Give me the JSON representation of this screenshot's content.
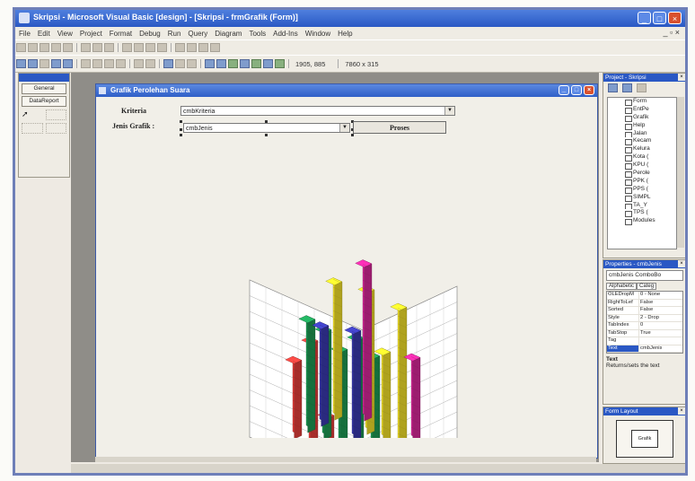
{
  "window": {
    "title": "Skripsi - Microsoft Visual Basic [design] - [Skripsi - frmGrafik (Form)]"
  },
  "menu": [
    "File",
    "Edit",
    "View",
    "Project",
    "Format",
    "Debug",
    "Run",
    "Query",
    "Diagram",
    "Tools",
    "Add-Ins",
    "Window",
    "Help"
  ],
  "toolbar": {
    "position": "1905, 885",
    "size": "7860 x 315"
  },
  "toolbox": {
    "tabs": [
      "General",
      "DataReport"
    ]
  },
  "form": {
    "caption": "Grafik Perolehan Suara",
    "kriteria_label": "Kriteria",
    "kriteria_value": "cmbKriteria",
    "jenis_label": "Jenis Grafik :",
    "jenis_value": "cmbJenis",
    "button_label": "Proses"
  },
  "project": {
    "title": "Project - Skripsi",
    "items": [
      "Form",
      "EntPe",
      "Grafik",
      "Help",
      "Jalan",
      "Kecam",
      "Kelura",
      "Kota (",
      "KPU (",
      "Perole",
      "PPK (",
      "PPS (",
      "SIMPL",
      "TA_Y",
      "TPS (",
      "Modules"
    ]
  },
  "properties": {
    "title": "Properties - cmbJenis",
    "object": "cmbJenis ComboBo",
    "tabs": [
      "Alphabetic",
      "Categ"
    ],
    "rows": [
      {
        "k": "OLEDropM",
        "v": "0 - None"
      },
      {
        "k": "RightToLef",
        "v": "False"
      },
      {
        "k": "Sorted",
        "v": "False"
      },
      {
        "k": "Style",
        "v": "2 - Drop"
      },
      {
        "k": "TabIndex",
        "v": "0"
      },
      {
        "k": "TabStop",
        "v": "True"
      },
      {
        "k": "Tag",
        "v": ""
      },
      {
        "k": "Text",
        "v": "cmbJenis"
      },
      {
        "k": "ToolTipTex",
        "v": ""
      }
    ],
    "desc_title": "Text",
    "desc_text": "Returns/sets the text"
  },
  "form_layout": {
    "title": "Form Layout",
    "mini_label": "Grafik"
  },
  "chart_data": {
    "type": "bar",
    "subtype": "3d-stacked-columns",
    "title": "",
    "zlabel": "",
    "colors": {
      "red": "#e8403c",
      "green": "#1f9b55",
      "blue": "#3a3ab0",
      "yellow": "#f3e12a",
      "magenta": "#d8289a"
    },
    "series": [
      {
        "color": "red",
        "values": [
          48,
          65,
          22,
          0,
          0
        ]
      },
      {
        "color": "green",
        "values": [
          70,
          68,
          60,
          72,
          65
        ]
      },
      {
        "color": "blue",
        "values": [
          62,
          0,
          68,
          0,
          0
        ]
      },
      {
        "color": "yellow",
        "values": [
          86,
          0,
          90,
          55,
          88
        ]
      },
      {
        "color": "magenta",
        "values": [
          0,
          98,
          0,
          0,
          52
        ]
      }
    ]
  }
}
